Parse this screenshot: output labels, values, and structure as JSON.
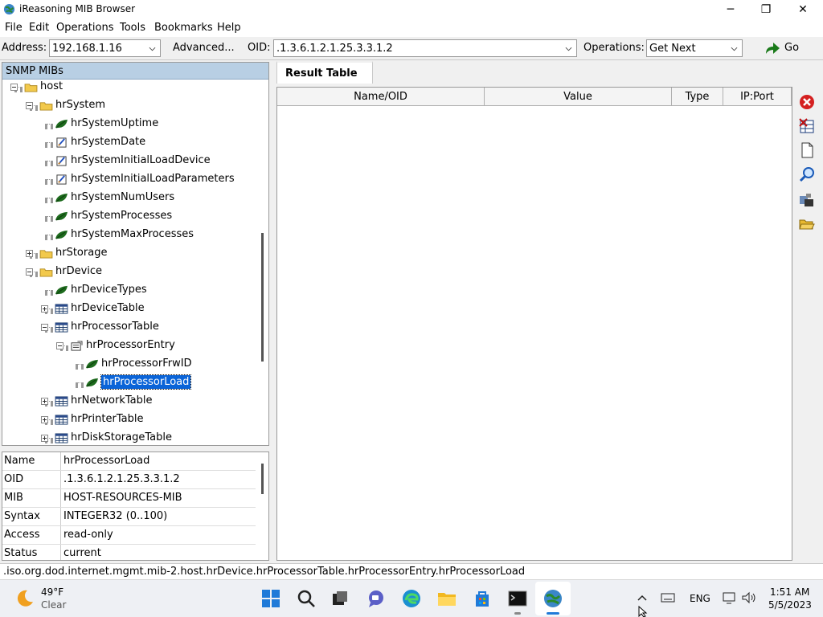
{
  "window": {
    "title": "iReasoning MIB Browser",
    "minimize_glyph": "─",
    "maximize_glyph": "❐",
    "close_glyph": "✕"
  },
  "menu": [
    "File",
    "Edit",
    "Operations",
    "Tools",
    "Bookmarks",
    "Help"
  ],
  "toolbar": {
    "address_label": "Address:",
    "address_value": "192.168.1.16",
    "advanced_label": "Advanced...",
    "oid_label": "OID:",
    "oid_value": ".1.3.6.1.2.1.25.3.3.1.2",
    "operations_label": "Operations:",
    "operations_value": "Get Next",
    "go_label": "Go"
  },
  "mib_tree": {
    "header": "SNMP MIBs",
    "items": [
      {
        "label": "host",
        "icon": "folder-icon"
      },
      {
        "label": "hrSystem",
        "icon": "folder-icon"
      },
      {
        "label": "hrSystemUptime",
        "icon": "leaf-icon"
      },
      {
        "label": "hrSystemDate",
        "icon": "writable-icon"
      },
      {
        "label": "hrSystemInitialLoadDevice",
        "icon": "writable-icon"
      },
      {
        "label": "hrSystemInitialLoadParameters",
        "icon": "writable-icon"
      },
      {
        "label": "hrSystemNumUsers",
        "icon": "leaf-icon"
      },
      {
        "label": "hrSystemProcesses",
        "icon": "leaf-icon"
      },
      {
        "label": "hrSystemMaxProcesses",
        "icon": "leaf-icon"
      },
      {
        "label": "hrStorage",
        "icon": "folder-icon"
      },
      {
        "label": "hrDevice",
        "icon": "folder-icon"
      },
      {
        "label": "hrDeviceTypes",
        "icon": "leaf-icon"
      },
      {
        "label": "hrDeviceTable",
        "icon": "table-icon"
      },
      {
        "label": "hrProcessorTable",
        "icon": "table-icon"
      },
      {
        "label": "hrProcessorEntry",
        "icon": "entry-icon"
      },
      {
        "label": "hrProcessorFrwID",
        "icon": "leaf-icon"
      },
      {
        "label": "hrProcessorLoad",
        "icon": "leaf-icon",
        "selected": true
      },
      {
        "label": "hrNetworkTable",
        "icon": "table-icon"
      },
      {
        "label": "hrPrinterTable",
        "icon": "table-icon"
      },
      {
        "label": "hrDiskStorageTable",
        "icon": "table-icon"
      }
    ]
  },
  "properties": [
    {
      "key": "Name",
      "value": "hrProcessorLoad"
    },
    {
      "key": "OID",
      "value": ".1.3.6.1.2.1.25.3.3.1.2"
    },
    {
      "key": "MIB",
      "value": "HOST-RESOURCES-MIB"
    },
    {
      "key": "Syntax",
      "value": "INTEGER32 (0..100)"
    },
    {
      "key": "Access",
      "value": "read-only"
    },
    {
      "key": "Status",
      "value": "current"
    }
  ],
  "result": {
    "tab_label": "Result Table",
    "columns": [
      "Name/OID",
      "Value",
      "Type",
      "IP:Port"
    ]
  },
  "status_bar": ".iso.org.dod.internet.mgmt.mib-2.host.hrDevice.hrProcessorTable.hrProcessorEntry.hrProcessorLoad",
  "taskbar": {
    "weather_temp": "49°F",
    "weather_desc": "Clear",
    "lang": "ENG",
    "time": "1:51 AM",
    "date": "5/5/2023"
  },
  "colors": {
    "selection": "#0a64d8",
    "header_blue": "#b8cfe4",
    "leaf_green": "#1e6b1e"
  }
}
